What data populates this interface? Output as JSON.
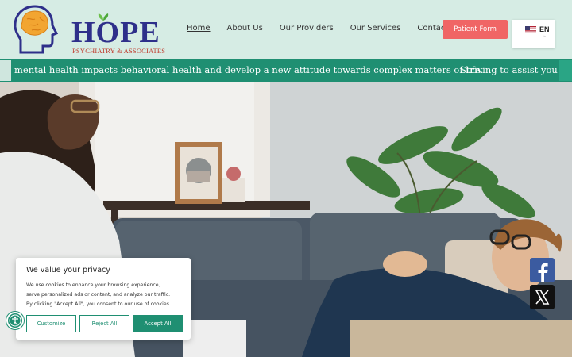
{
  "brand": {
    "name": "HOPE",
    "tagline": "PSYCHIATRY & ASSOCIATES"
  },
  "nav": {
    "items": [
      {
        "label": "Home",
        "active": true
      },
      {
        "label": "About Us"
      },
      {
        "label": "Our Providers"
      },
      {
        "label": "Our Services"
      },
      {
        "label": "Contact Us"
      }
    ]
  },
  "cta": {
    "patient_form": "Patient Form"
  },
  "language": {
    "code": "EN"
  },
  "ticker": {
    "text_1": "mental health impacts behavioral health and develop a new attitude towards complex matters of life.",
    "text_2": "Striving to assist you in lea"
  },
  "cookie": {
    "title": "We value your privacy",
    "line1": "We use cookies to enhance your browsing experience,",
    "line2": "serve personalized ads or content, and analyze our traffic.",
    "line3": "By clicking \"Accept All\", you consent to our use of cookies.",
    "customize": "Customize",
    "reject": "Reject All",
    "accept": "Accept All"
  },
  "colors": {
    "brand_navy": "#2e2f8a",
    "brand_teal": "#1f8f72",
    "cta_red": "#f06565",
    "header_bg": "#d6ece4"
  },
  "icons": {
    "logo": "head-brain-icon",
    "accessibility": "accessibility-icon",
    "facebook": "facebook-icon",
    "x": "x-twitter-icon",
    "flag": "us-flag-icon"
  }
}
